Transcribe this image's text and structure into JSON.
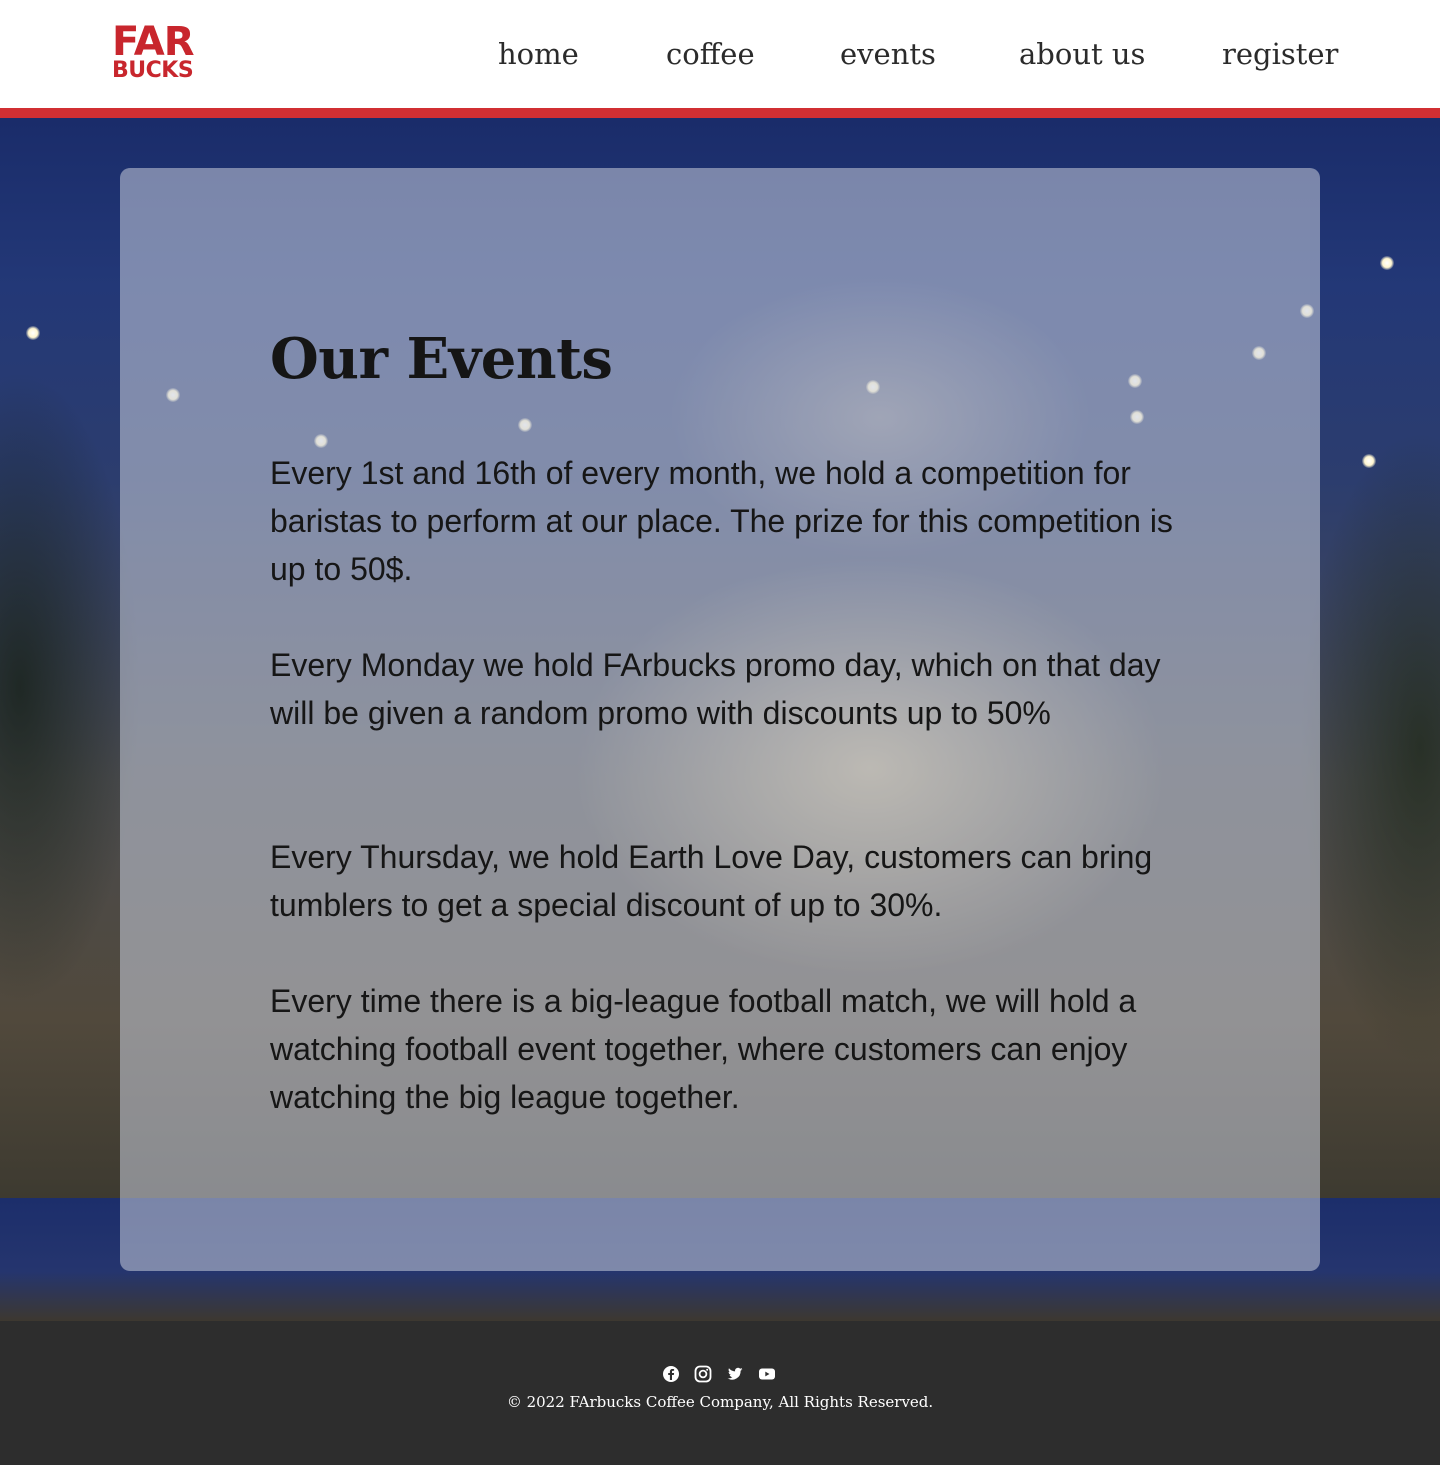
{
  "brand": {
    "logo_top": "FAR",
    "logo_bottom": "BUCKS",
    "logo_color": "#c8262d",
    "accent_stripe_color": "#d12f33"
  },
  "nav": {
    "items": [
      {
        "label": "home"
      },
      {
        "label": "coffee"
      },
      {
        "label": "events"
      },
      {
        "label": "about us"
      },
      {
        "label": "register"
      }
    ]
  },
  "main": {
    "title": "Our Events",
    "events": [
      {
        "text": "Every 1st and 16th of every month, we hold a competition for baristas to perform at our place. The prize for this competition is up to 50$."
      },
      {
        "text": "Every Monday we hold FArbucks promo day, which on that day will be given a random promo with discounts up to 50%"
      },
      {
        "text": "Every Thursday, we hold Earth Love Day, customers can bring tumblers to get a special discount of up to 30%."
      },
      {
        "text": "Every time there is a big-league football match, we will hold a watching football event together, where customers can enjoy watching the big league together."
      }
    ]
  },
  "footer": {
    "social_icons": [
      "facebook-icon",
      "instagram-icon",
      "twitter-icon",
      "youtube-icon"
    ],
    "copyright": "© 2022 FArbucks Coffee Company, All Rights Reserved."
  }
}
